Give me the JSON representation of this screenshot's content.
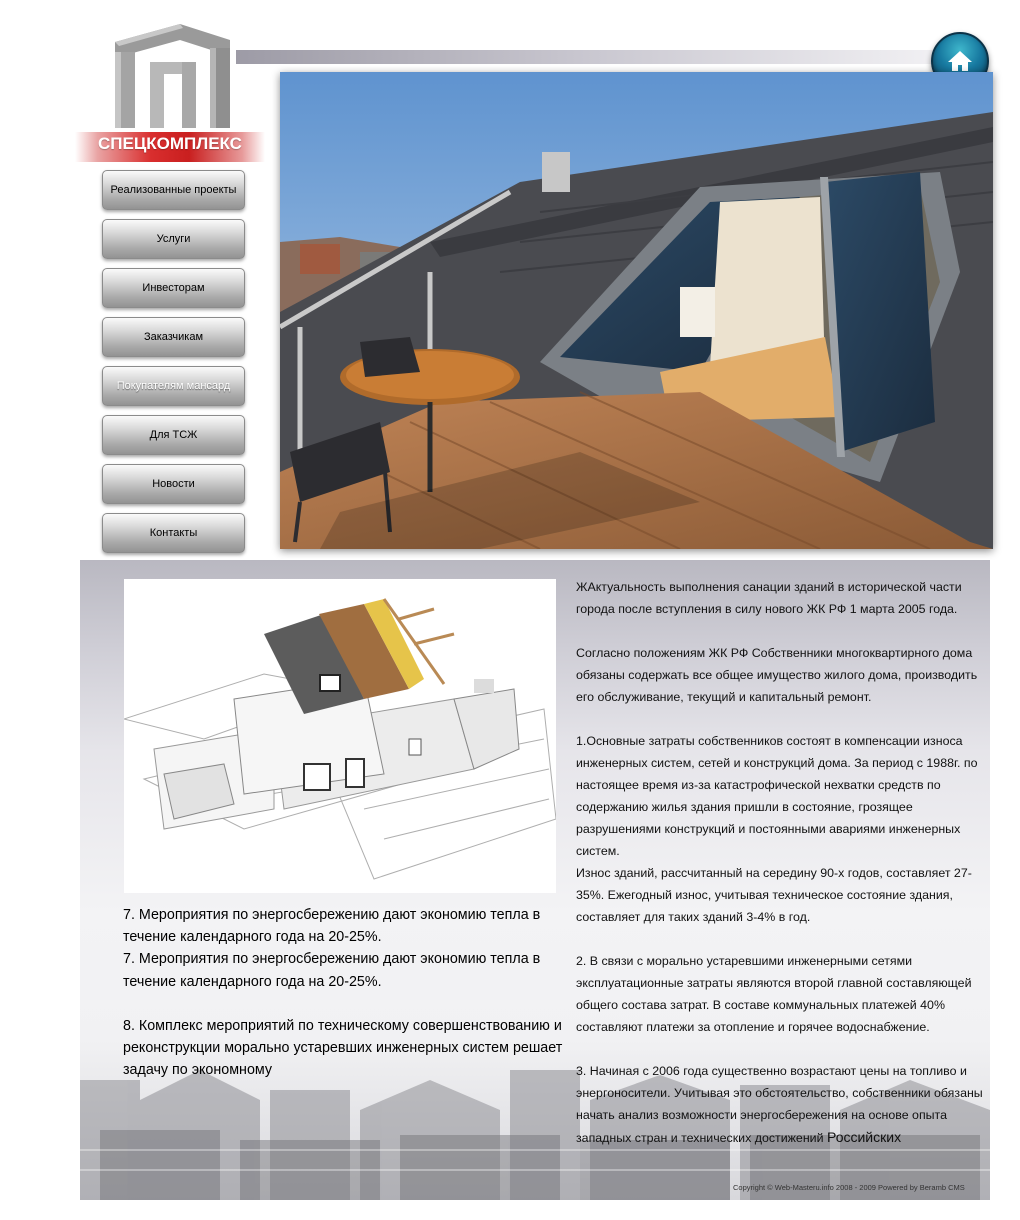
{
  "logo": {
    "text": "СПЕЦКОМПЛЕКС"
  },
  "header": {
    "home_icon": "home-icon"
  },
  "nav": {
    "items": [
      {
        "label": "Реализованные проекты",
        "active": false
      },
      {
        "label": "Услуги",
        "active": false
      },
      {
        "label": "Инвесторам",
        "active": false
      },
      {
        "label": "Заказчикам",
        "active": false
      },
      {
        "label": "Покупателям мансард",
        "active": true
      },
      {
        "label": "Для ТСЖ",
        "active": false
      },
      {
        "label": "Новости",
        "active": false
      },
      {
        "label": "Контакты",
        "active": false
      }
    ]
  },
  "content": {
    "left": {
      "p1": "7. Мероприятия по энергосбережению дают экономию тепла в течение календарного года на 20-25%.",
      "p2": " 7. Мероприятия по энергосбережению дают экономию тепла в течение календарного года на 20-25%.",
      "p3": "8. Комплекс мероприятий по техническому совершенствованию и реконструкции морально устаревших инженерных систем решает задачу по экономному"
    },
    "right": {
      "intro": "ЖАктуальность выполнения санации зданий в исторической части города после вступления в силу нового ЖК РФ 1 марта 2005 года.",
      "law": "Согласно положениям ЖК РФ Собственники многоквартирного дома обязаны содержать все общее имущество жилого дома, производить его обслуживание, текущий и капитальный ремонт.",
      "item1": "1.Основные затраты собственников состоят в компенсации износа инженерных систем, сетей и конструкций дома. За период с 1988г. по настоящее время из-за катастрофической нехватки средств по содержанию жилья здания пришли в состояние, грозящее разрушениями конструкций и постоянными авариями инженерных систем.",
      "item1b": "Износ зданий, рассчитанный на середину 90-х годов, составляет 27-35%. Ежегодный износ, учитывая техническое состояние здания, составляет для таких зданий 3-4% в год.",
      "item2": "2. В связи с морально устаревшими инженерными сетями эксплуатационные затраты являются второй главной составляющей общего состава затрат. В составе коммунальных платежей 40% составляют платежи за отопление и горячее водоснабжение.",
      "item3": "3. Начиная с 2006 года существенно возрастают цены на топливо и энергоносители. Учитывая это обстоятельство, собственники обязаны начать анализ возможности энергосбережения на основе опыта западных стран и технических достижений",
      "item3_tail": "Российских"
    }
  },
  "footer": {
    "copyright": "Copyright © Web-Masteru.info 2008 - 2009  Powered by Beramb CMS"
  },
  "colors": {
    "accent": "#c91f1f",
    "home": "#1779a0"
  }
}
